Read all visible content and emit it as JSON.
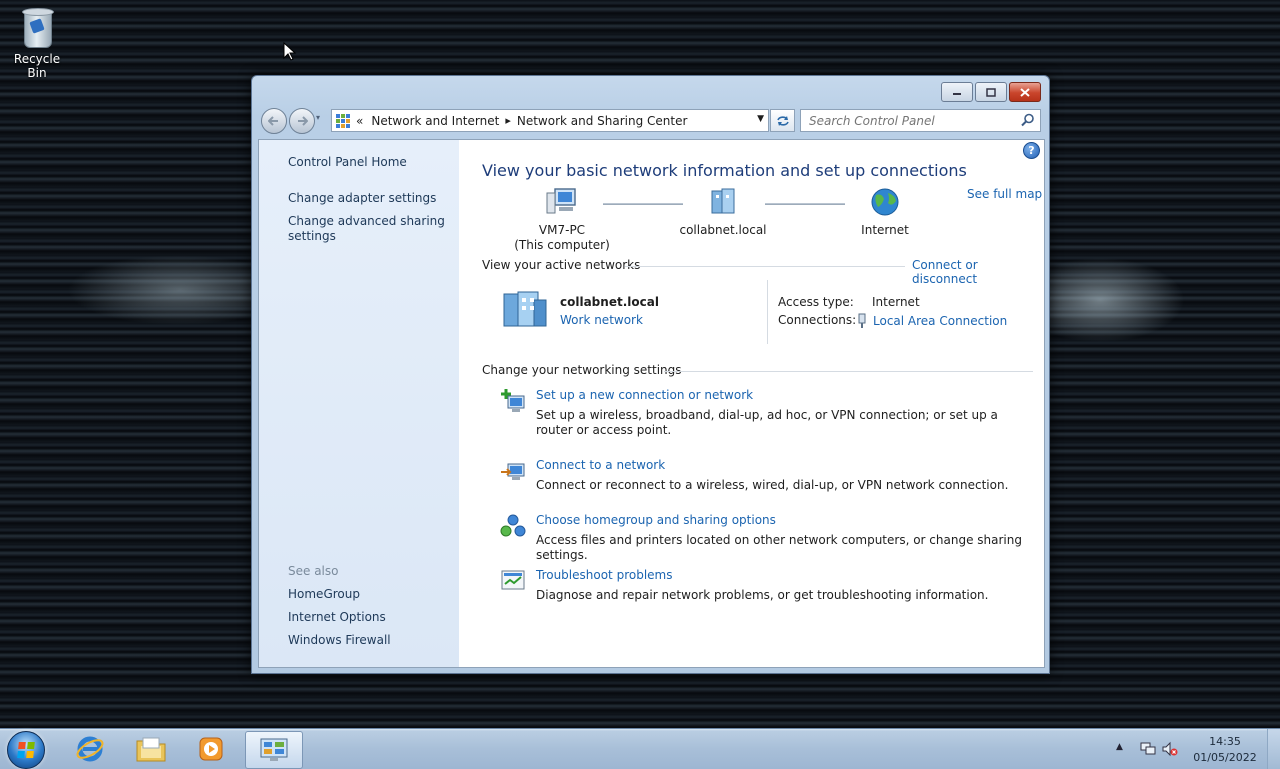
{
  "desktop": {
    "icons": [
      {
        "label": "Recycle Bin",
        "icon": "recycle-bin-icon"
      }
    ]
  },
  "window": {
    "caption_buttons": {
      "minimize": "minimize",
      "maximize": "maximize",
      "close": "close"
    },
    "address": {
      "prefix": "«",
      "crumbs": [
        "Network and Internet",
        "Network and Sharing Center"
      ],
      "separator": "▸"
    },
    "search": {
      "placeholder": "Search Control Panel"
    },
    "sidebar": {
      "home": "Control Panel Home",
      "adapter": "Change adapter settings",
      "advanced": "Change advanced sharing settings",
      "see_also_heading": "See also",
      "see_also": [
        "HomeGroup",
        "Internet Options",
        "Windows Firewall"
      ]
    },
    "main": {
      "title": "View your basic network information and set up connections",
      "see_full_map": "See full map",
      "map": {
        "computer": {
          "name": "VM7-PC",
          "sub": "(This computer)"
        },
        "network": {
          "name": "collabnet.local"
        },
        "internet": {
          "name": "Internet"
        }
      },
      "active_networks": {
        "heading": "View your active networks",
        "connect_link": "Connect or disconnect",
        "network_name": "collabnet.local",
        "network_type": "Work network",
        "access_type_label": "Access type:",
        "access_type_value": "Internet",
        "connections_label": "Connections:",
        "connections_value": "Local Area Connection"
      },
      "settings": {
        "heading": "Change your networking settings",
        "tasks": [
          {
            "title": "Set up a new connection or network",
            "desc": "Set up a wireless, broadband, dial-up, ad hoc, or VPN connection; or set up a router or access point.",
            "icon": "new-connection-icon"
          },
          {
            "title": "Connect to a network",
            "desc": "Connect or reconnect to a wireless, wired, dial-up, or VPN network connection.",
            "icon": "connect-network-icon"
          },
          {
            "title": "Choose homegroup and sharing options",
            "desc": "Access files and printers located on other network computers, or change sharing settings.",
            "icon": "homegroup-icon"
          },
          {
            "title": "Troubleshoot problems",
            "desc": "Diagnose and repair network problems, or get troubleshooting information.",
            "icon": "troubleshoot-icon"
          }
        ]
      }
    }
  },
  "taskbar": {
    "pinned": [
      "internet-explorer-icon",
      "windows-explorer-icon",
      "media-player-icon",
      "control-panel-icon"
    ],
    "clock": {
      "time": "14:35",
      "date": "01/05/2022"
    }
  },
  "colors": {
    "link": "#1b64b0",
    "title": "#1e3d7a",
    "sidebar_bg": "#e6effa"
  }
}
